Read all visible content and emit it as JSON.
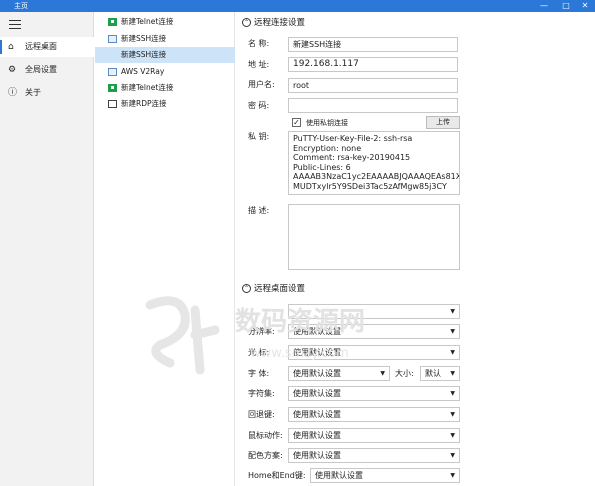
{
  "window": {
    "title": "主页",
    "controls": [
      "—",
      "□",
      "✕"
    ]
  },
  "sidebar": {
    "items": [
      {
        "label": "远程桌面",
        "icon": "home-icon",
        "glyph": "⌂",
        "active": true
      },
      {
        "label": "全局设置",
        "icon": "gear-icon",
        "glyph": "⚙",
        "active": false
      },
      {
        "label": "关于",
        "icon": "info-icon",
        "glyph": "ⓘ",
        "active": false
      }
    ]
  },
  "connections": [
    {
      "label": "新建Telnet连接",
      "icon": "telnet-icon",
      "selected": false
    },
    {
      "label": "新建SSH连接",
      "icon": "ssh-icon",
      "selected": false
    },
    {
      "label": "新建SSH连接",
      "icon": "none",
      "selected": true
    },
    {
      "label": "AWS V2Ray",
      "icon": "ssh-icon",
      "selected": false
    },
    {
      "label": "新建Telnet连接",
      "icon": "telnet-icon",
      "selected": false
    },
    {
      "label": "新建RDP连接",
      "icon": "monitor-icon",
      "selected": false
    }
  ],
  "remote": {
    "header": "远程连接设置",
    "name_label": "名   称:",
    "name_value": "新建SSH连接",
    "addr_label": "地   址:",
    "addr_value": "192.168.1.117",
    "user_label": "用户名:",
    "user_value": "root",
    "pass_label": "密   码:",
    "pass_value": "",
    "use_key_label": "使用私钥连接",
    "use_key_checked": true,
    "upload_label": "上传",
    "key_label": "私   钥:",
    "key_lines": [
      "PuTTY-User-Key-File-2: ssh-rsa",
      "Encryption: none",
      "Comment: rsa-key-20190415",
      "Public-Lines: 6",
      "AAAAB3NzaC1yc2EAAAABJQAAAQEAs81X",
      "MUDTxylr5Y9SDei3Tac5zAfMgw85j3CY"
    ],
    "desc_label": "描   述:",
    "desc_value": ""
  },
  "desktop": {
    "header": "远程桌面设置",
    "rows": [
      {
        "label": "",
        "value": "",
        "name": "resolution"
      },
      {
        "label": "分辨率:",
        "value": "使用默认设置",
        "name": "resolution-2"
      },
      {
        "label": "光   标:",
        "value": "使用默认设置",
        "name": "cursor"
      },
      {
        "label": "字   体:",
        "value": "使用默认设置",
        "name": "font",
        "size_label": "大小:",
        "size_value": "默认"
      },
      {
        "label": "字符集:",
        "value": "使用默认设置",
        "name": "charset"
      },
      {
        "label": "回退键:",
        "value": "使用默认设置",
        "name": "backspace"
      },
      {
        "label": "鼠标动作:",
        "value": "使用默认设置",
        "name": "mouse-action"
      },
      {
        "label": "配色方案:",
        "value": "使用默认设置",
        "name": "color-scheme"
      },
      {
        "label": "Home和End键:",
        "value": "使用默认设置",
        "name": "home-end"
      }
    ]
  },
  "watermark": {
    "title": "数码资源网",
    "url": "www.smzy.com"
  }
}
